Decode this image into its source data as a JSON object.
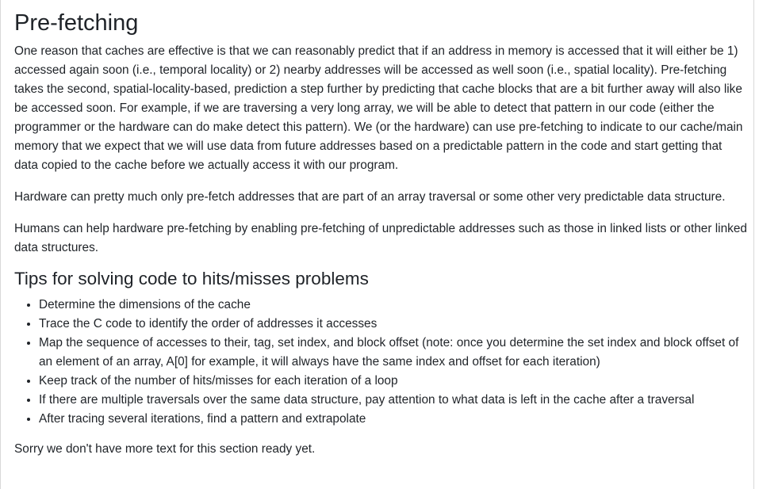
{
  "title": "Pre-fetching",
  "paragraphs": [
    "One reason that caches are effective is that we can reasonably predict that if an address in memory is accessed that it will either be 1) accessed again soon (i.e., temporal locality) or 2) nearby addresses will be accessed as well soon (i.e., spatial locality). Pre-fetching takes the second, spatial-locality-based, prediction a step further by predicting that cache blocks that are a bit further away will also like be accessed soon. For example, if we are traversing a very long array, we will be able to detect that pattern in our code (either the programmer or the hardware can do make detect this pattern). We (or the hardware) can use pre-fetching to indicate to our cache/main memory that we expect that we will use data from future addresses based on a predictable pattern in the code and start getting that data copied to the cache before we actually access it with our program.",
    "Hardware can pretty much only pre-fetch addresses that are part of an array traversal or some other very predictable data structure.",
    "Humans can help hardware pre-fetching by enabling pre-fetching of unpredictable addresses such as those in linked lists or other linked data structures."
  ],
  "tips": {
    "heading": "Tips for solving code to hits/misses problems",
    "items": [
      "Determine the dimensions of the cache",
      "Trace the C code to identify the order of addresses it accesses",
      "Map the sequence of accesses to their, tag, set index, and block offset (note: once you determine the set index and block offset of an element of an array, A[0] for example, it will always have the same index and offset for each iteration)",
      "Keep track of the number of hits/misses for each iteration of a loop",
      "If there are multiple traversals over the same data structure, pay attention to what data is left in the cache after a traversal",
      "After tracing several iterations, find a pattern and extrapolate"
    ]
  },
  "footer_note": "Sorry we don't have more text for this section ready yet."
}
